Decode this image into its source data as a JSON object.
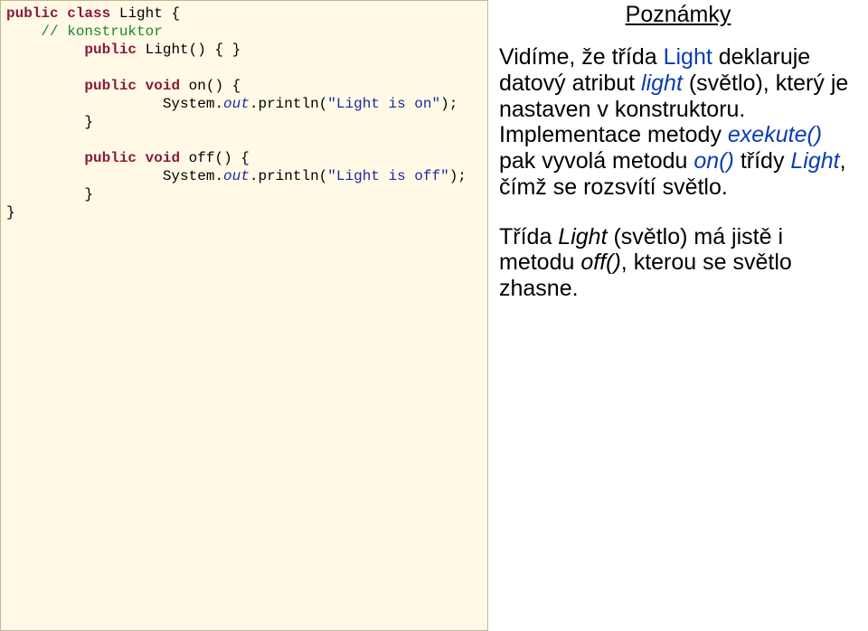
{
  "notes": {
    "title": "Poznámky",
    "p1a": "Vidíme, že třída ",
    "p1b_light": "Light",
    "p1c": " deklaruje datový atribut ",
    "p1d_lightattr": "light",
    "p1e": " (světlo), který je nastaven v konstruktoru. Implementace metody ",
    "p1f_execute": "exekute()",
    "p1g": " pak vyvolá metodu ",
    "p1h_on": "on()",
    "p1i": " třídy ",
    "p1j_light2": "Light",
    "p1k": ", čímž se rozsvítí světlo.",
    "p2a": "Třída ",
    "p2b_light": "Light",
    "p2c": " (světlo) má jistě i metodu ",
    "p2d_off": "off()",
    "p2e": ", kterou se světlo zhasne."
  },
  "code": {
    "kw_public1": "public",
    "kw_class": "class",
    "cls_light": "Light",
    "brace_open": "{",
    "comment_ctor": "// konstruktor",
    "kw_public2": "public",
    "ctor_name": "Light()",
    "ctor_body": "{ }",
    "kw_public3": "public",
    "kw_void1": "void",
    "method_on": "on()",
    "brace_open2": "{",
    "sys": "System.",
    "out": "out",
    "println1_a": ".println(",
    "str_on": "\"Light is on\"",
    "println1_b": ");",
    "brace_close1": "}",
    "kw_public4": "public",
    "kw_void2": "void",
    "method_off": "off()",
    "brace_open3": "{",
    "println2_a": ".println(",
    "str_off": "\"Light is off\"",
    "println2_b": ");",
    "brace_close2": "}",
    "brace_close3": "}"
  }
}
